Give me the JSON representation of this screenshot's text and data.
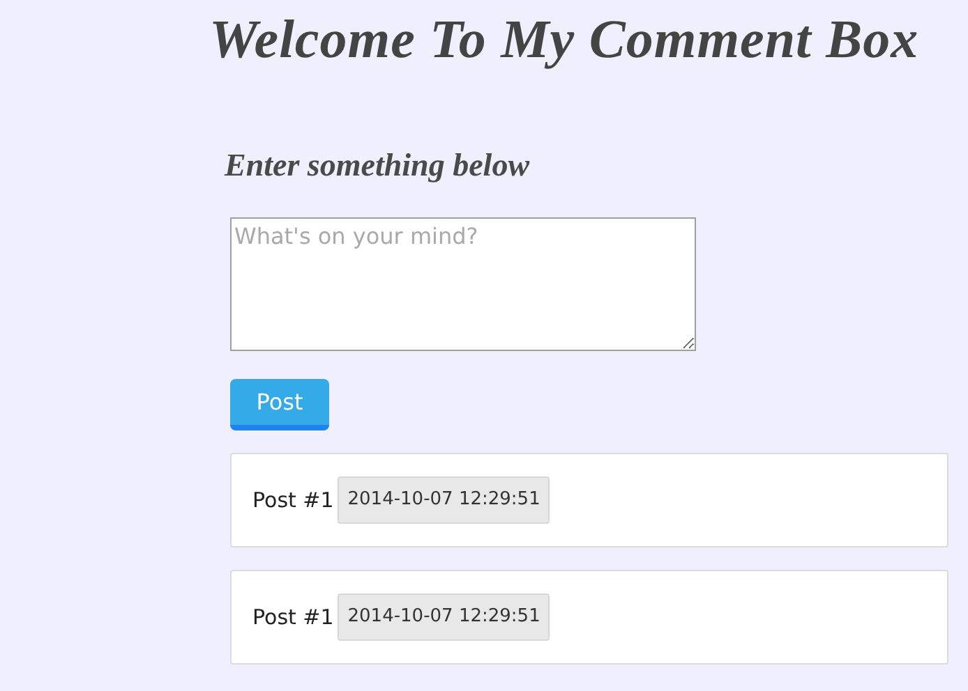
{
  "title": "Welcome To My Comment Box",
  "form": {
    "heading": "Enter something below",
    "textarea": {
      "placeholder": "What's on your mind?"
    },
    "submit_button": "Post"
  },
  "posts": [
    {
      "label": "Post #1",
      "timestamp": "2014-10-07 12:29:51"
    },
    {
      "label": "Post #1",
      "timestamp": "2014-10-07 12:29:51"
    }
  ]
}
